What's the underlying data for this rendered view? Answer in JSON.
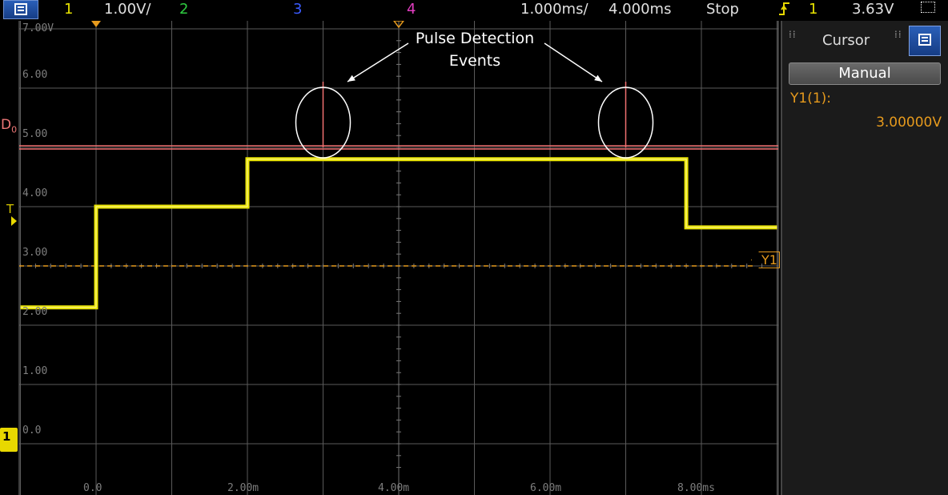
{
  "topbar": {
    "channel1": "1",
    "volts_per_div": "1.00V/",
    "channel2": "2",
    "channel3": "3",
    "channel4": "4",
    "time_per_div": "1.000ms/",
    "time_delay": "4.000ms",
    "run_state": "Stop",
    "trigger_channel": "1",
    "trigger_level": "3.63V"
  },
  "colors": {
    "channel1": "#e8e300",
    "channel2": "#2ecc40",
    "channel3": "#3b5bff",
    "channel4": "#e23dc0",
    "d0": "#f07070",
    "cursor": "#e69a1d",
    "panel_bg": "#1b1b1b",
    "menu_blue": "#1f4fa8"
  },
  "screen": {
    "y_ticks": [
      "7.00V",
      "6.00",
      "5.00",
      "4.00",
      "3.00",
      "2.00",
      "1.00",
      "0.0"
    ],
    "x_ticks": [
      "0.0",
      "2.00m",
      "4.00m",
      "6.00m",
      "8.00ms"
    ],
    "d0_label": "D",
    "d0_sub": "0",
    "trigger_label": "T",
    "cursor_tag": "Y1",
    "ground_tag": "1",
    "callout": "Pulse Detection Events"
  },
  "panel": {
    "title": "Cursor",
    "mode_button": "Manual",
    "cursor_name": "Y1(1):",
    "cursor_value": "3.00000V"
  },
  "chart_data": {
    "type": "line",
    "xlabel": "",
    "ylabel": "",
    "xlim": [
      -1.0,
      9.0
    ],
    "ylim": [
      -0.5,
      7.0
    ],
    "series": [
      {
        "x": [
          -1.0,
          0.0,
          0.0,
          2.0,
          2.0,
          7.8,
          7.8,
          9.0
        ],
        "y": [
          2.3,
          2.3,
          4.0,
          4.0,
          4.8,
          4.8,
          3.65,
          3.65
        ]
      }
    ],
    "reference_lines": {
      "d0_level": 5.0,
      "y1_cursor": 3.0
    },
    "pulse_events_x": [
      3.0,
      7.0
    ],
    "annotations": [
      "Pulse Detection Events"
    ],
    "grid": true
  },
  "icons": [
    "menu-icon",
    "trigger-edge-icon",
    "selection-box-icon",
    "grip-icon"
  ]
}
